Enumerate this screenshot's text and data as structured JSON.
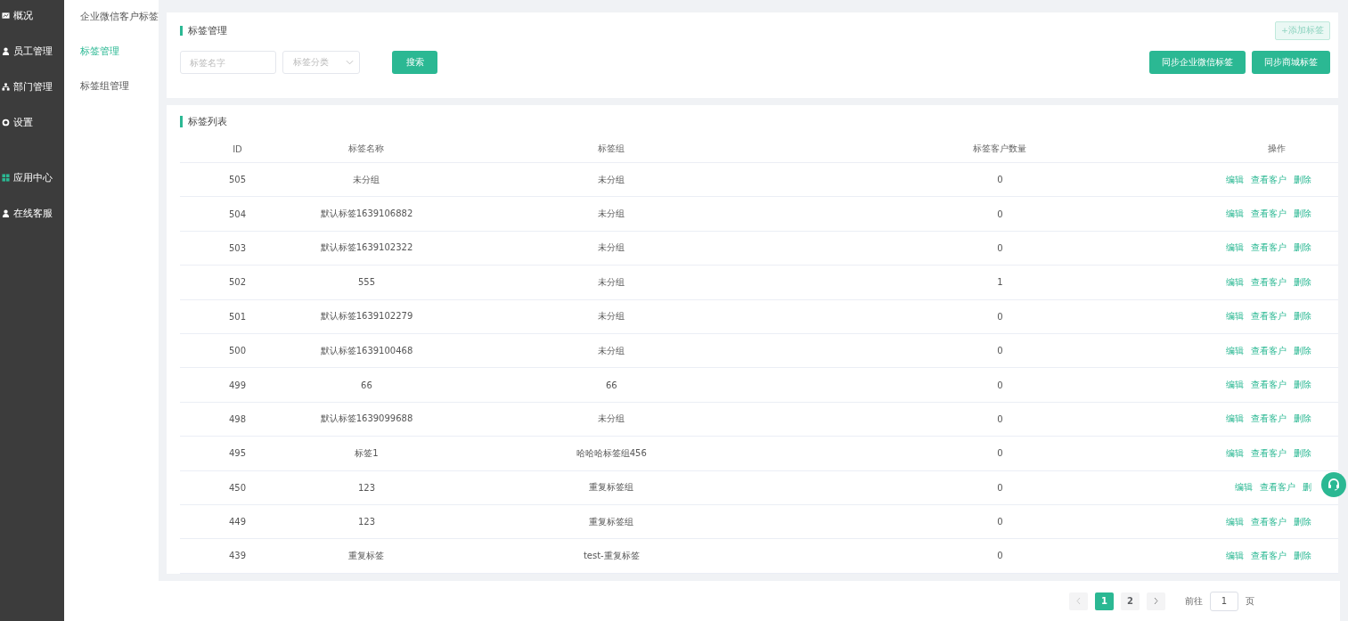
{
  "sidebar": {
    "items": [
      {
        "label": "概况",
        "selected": false
      },
      {
        "label": "员工管理",
        "selected": false
      },
      {
        "label": "部门管理",
        "selected": false
      },
      {
        "label": "设置",
        "selected": false
      },
      {
        "label": "应用中心",
        "selected": false
      },
      {
        "label": "在线客服",
        "selected": false
      }
    ]
  },
  "submenu": {
    "items": [
      {
        "label": "企业微信客户标签",
        "selected": false
      },
      {
        "label": "标签管理",
        "selected": true
      },
      {
        "label": "标签组管理",
        "selected": false
      }
    ]
  },
  "filter_panel": {
    "title": "标签管理",
    "add_button": "+添加标签",
    "name_field": {
      "placeholder": "标签名字"
    },
    "category_select": {
      "placeholder": "标签分类"
    },
    "search_button": "搜索",
    "sync_buttons": [
      "同步企业微信标签",
      "同步商城标签"
    ]
  },
  "table": {
    "title": "标签列表",
    "columns": [
      "ID",
      "标签名称",
      "标签组",
      "标签客户数量",
      "操作"
    ],
    "rows": [
      {
        "cells": [
          "505",
          "未分组",
          "未分组",
          "0"
        ],
        "actions": [
          "编辑",
          "查看客户",
          "删除"
        ]
      },
      {
        "cells": [
          "504",
          "默认标签1639106882",
          "未分组",
          "0"
        ],
        "actions": [
          "编辑",
          "查看客户",
          "删除"
        ]
      },
      {
        "cells": [
          "503",
          "默认标签1639102322",
          "未分组",
          "0"
        ],
        "actions": [
          "编辑",
          "查看客户",
          "删除"
        ]
      },
      {
        "cells": [
          "502",
          "555",
          "未分组",
          "1"
        ],
        "actions": [
          "编辑",
          "查看客户",
          "删除"
        ]
      },
      {
        "cells": [
          "501",
          "默认标签1639102279",
          "未分组",
          "0"
        ],
        "actions": [
          "编辑",
          "查看客户",
          "删除"
        ]
      },
      {
        "cells": [
          "500",
          "默认标签1639100468",
          "未分组",
          "0"
        ],
        "actions": [
          "编辑",
          "查看客户",
          "删除"
        ]
      },
      {
        "cells": [
          "499",
          "66",
          "66",
          "0"
        ],
        "actions": [
          "编辑",
          "查看客户",
          "删除"
        ]
      },
      {
        "cells": [
          "498",
          "默认标签1639099688",
          "未分组",
          "0"
        ],
        "actions": [
          "编辑",
          "查看客户",
          "删除"
        ]
      },
      {
        "cells": [
          "495",
          "标签1",
          "哈哈哈标签组456",
          "0"
        ],
        "actions": [
          "编辑",
          "查看客户",
          "删除"
        ]
      },
      {
        "cells": [
          "450",
          "123",
          "重复标签组",
          "0"
        ],
        "actions": [
          "编辑",
          "查看客户",
          "删"
        ]
      },
      {
        "cells": [
          "449",
          "123",
          "重复标签组",
          "0"
        ],
        "actions": [
          "编辑",
          "查看客户",
          "删除"
        ]
      },
      {
        "cells": [
          "439",
          "重复标签",
          "test-重复标签",
          "0"
        ],
        "actions": [
          "编辑",
          "查看客户",
          "删除"
        ]
      }
    ]
  },
  "pagination": {
    "pages": [
      {
        "label": "1",
        "selected": true
      },
      {
        "label": "2",
        "selected": false
      }
    ],
    "goto_label": "前往",
    "goto_value": "1",
    "page_unit": "页"
  }
}
